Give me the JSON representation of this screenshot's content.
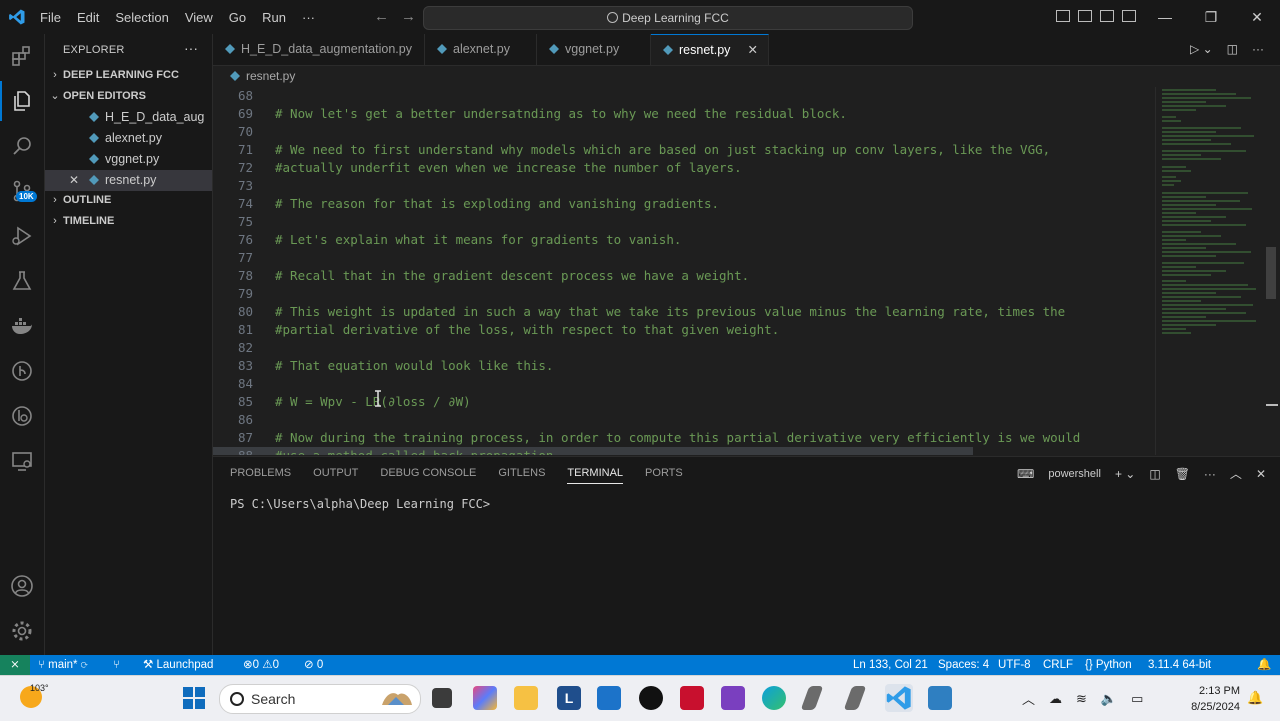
{
  "titlebar": {
    "menu": [
      "File",
      "Edit",
      "Selection",
      "View",
      "Go",
      "Run",
      "···"
    ],
    "search_text": "Deep Learning FCC"
  },
  "activity": {
    "scm_badge": "10K"
  },
  "sidebar": {
    "header": "EXPLORER",
    "more": "···",
    "folder": "DEEP LEARNING FCC",
    "open_editors_title": "OPEN EDITORS",
    "open_editors": [
      {
        "name": "H_E_D_data_aug...",
        "selected": false
      },
      {
        "name": "alexnet.py",
        "selected": false
      },
      {
        "name": "vggnet.py",
        "selected": false
      },
      {
        "name": "resnet.py",
        "selected": true
      }
    ],
    "outline": "OUTLINE",
    "timeline": "TIMELINE"
  },
  "tabs": [
    {
      "label": "H_E_D_data_augmentation.py",
      "active": false
    },
    {
      "label": "alexnet.py",
      "active": false
    },
    {
      "label": "vggnet.py",
      "active": false
    },
    {
      "label": "resnet.py",
      "active": true
    }
  ],
  "breadcrumb": "resnet.py",
  "editor": {
    "lines": [
      {
        "n": "68",
        "text": ""
      },
      {
        "n": "69",
        "text": "# Now let's get a better undersatnding as to why we need the residual block."
      },
      {
        "n": "70",
        "text": ""
      },
      {
        "n": "71",
        "text": "# We need to first understand why models which are based on just stacking up conv layers, like the VGG,"
      },
      {
        "n": "72",
        "text": "#actually underfit even when we increase the number of layers."
      },
      {
        "n": "73",
        "text": ""
      },
      {
        "n": "74",
        "text": "# The reason for that is exploding and vanishing gradients."
      },
      {
        "n": "75",
        "text": ""
      },
      {
        "n": "76",
        "text": "# Let's explain what it means for gradients to vanish."
      },
      {
        "n": "77",
        "text": ""
      },
      {
        "n": "78",
        "text": "# Recall that in the gradient descent process we have a weight."
      },
      {
        "n": "79",
        "text": ""
      },
      {
        "n": "80",
        "text": "# This weight is updated in such a way that we take its previous value minus the learning rate, times the"
      },
      {
        "n": "81",
        "text": "#partial derivative of the loss, with respect to that given weight."
      },
      {
        "n": "82",
        "text": ""
      },
      {
        "n": "83",
        "text": "# That equation would look like this."
      },
      {
        "n": "84",
        "text": ""
      },
      {
        "n": "85",
        "text": "# W = Wpv - LR(∂loss / ∂W)"
      },
      {
        "n": "86",
        "text": ""
      },
      {
        "n": "87",
        "text": "# Now during the training process, in order to compute this partial derivative very efficiently is we would"
      },
      {
        "n": "88",
        "text": "#use a method called back propagation."
      }
    ]
  },
  "panel": {
    "tabs": [
      "PROBLEMS",
      "OUTPUT",
      "DEBUG CONSOLE",
      "GITLENS",
      "TERMINAL",
      "PORTS"
    ],
    "active_tab": "TERMINAL",
    "shell": "powershell",
    "prompt": "PS C:\\Users\\alpha\\Deep Learning FCC>"
  },
  "statusbar": {
    "branch": "main*",
    "launchpad": "Launchpad",
    "errors": "0",
    "warnings": "0",
    "ports": "0",
    "position": "Ln 133, Col 21",
    "spaces": "Spaces: 4",
    "encoding": "UTF-8",
    "eol": "CRLF",
    "language": "Python",
    "interpreter": "3.11.4 64-bit"
  },
  "taskbar": {
    "temperature": "103°",
    "search": "Search",
    "time": "2:13 PM",
    "date": "8/25/2024"
  },
  "colors": {
    "accent": "#0078d4",
    "comment": "#6a9955",
    "statusbar": "#0078d4",
    "remote": "#16825d"
  }
}
